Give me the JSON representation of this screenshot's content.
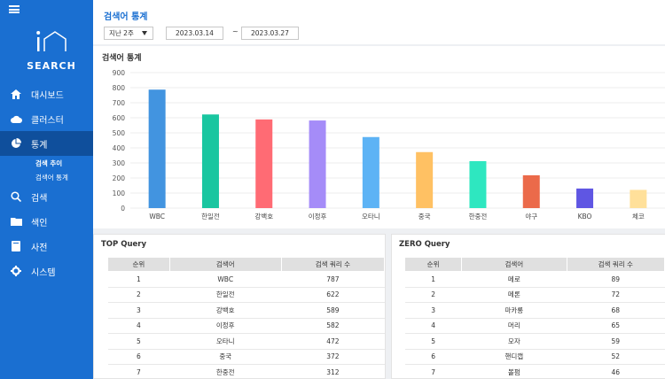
{
  "sidebar": {
    "logo_text": "SEARCH",
    "logo_mark": "i",
    "items": [
      {
        "label": "대시보드",
        "icon": "home-icon"
      },
      {
        "label": "클러스터",
        "icon": "cloud-icon"
      },
      {
        "label": "통계",
        "icon": "pie-chart-icon",
        "active": true
      },
      {
        "label": "검색",
        "icon": "search-icon"
      },
      {
        "label": "색인",
        "icon": "folder-icon"
      },
      {
        "label": "사전",
        "icon": "book-icon"
      },
      {
        "label": "시스템",
        "icon": "gear-icon"
      }
    ],
    "sub_items": [
      "검색 추이",
      "검색어 통계"
    ]
  },
  "header": {
    "title": "검색어 통계",
    "period": "지난 2주",
    "date_from": "2023.03.14",
    "separator": "~",
    "date_to": "2023.03.27"
  },
  "chart_panel": {
    "title": "검색어 통계"
  },
  "chart_data": {
    "type": "bar",
    "categories": [
      "WBC",
      "한일전",
      "강백호",
      "이정후",
      "오타니",
      "중국",
      "한중전",
      "야구",
      "KBO",
      "체코"
    ],
    "values": [
      787,
      622,
      589,
      582,
      472,
      372,
      312,
      218,
      130,
      121
    ],
    "colors": [
      "#4294e0",
      "#19c6a0",
      "#ff6b74",
      "#a58cf8",
      "#5db3f5",
      "#ffc163",
      "#2ee7c0",
      "#eb6a4a",
      "#5f56e3",
      "#ffe09a"
    ],
    "yticks": [
      0,
      100,
      200,
      300,
      400,
      500,
      600,
      700,
      800,
      900
    ],
    "ylim": [
      0,
      900
    ]
  },
  "top_query": {
    "title": "TOP Query",
    "headers": [
      "순위",
      "검색어",
      "검색 쿼리 수"
    ],
    "rows": [
      [
        "1",
        "WBC",
        "787"
      ],
      [
        "2",
        "한일전",
        "622"
      ],
      [
        "3",
        "강백호",
        "589"
      ],
      [
        "4",
        "이정후",
        "582"
      ],
      [
        "5",
        "오타니",
        "472"
      ],
      [
        "6",
        "중국",
        "372"
      ],
      [
        "7",
        "한중전",
        "312"
      ]
    ]
  },
  "zero_query": {
    "title": "ZERO Query",
    "headers": [
      "순위",
      "검색어",
      "검색 쿼리 수"
    ],
    "rows": [
      [
        "1",
        "메로",
        "89"
      ],
      [
        "2",
        "메론",
        "72"
      ],
      [
        "3",
        "마카롱",
        "68"
      ],
      [
        "4",
        "머리",
        "65"
      ],
      [
        "5",
        "모자",
        "59"
      ],
      [
        "6",
        "핸디캡",
        "52"
      ],
      [
        "7",
        "볼펌",
        "46"
      ]
    ]
  }
}
